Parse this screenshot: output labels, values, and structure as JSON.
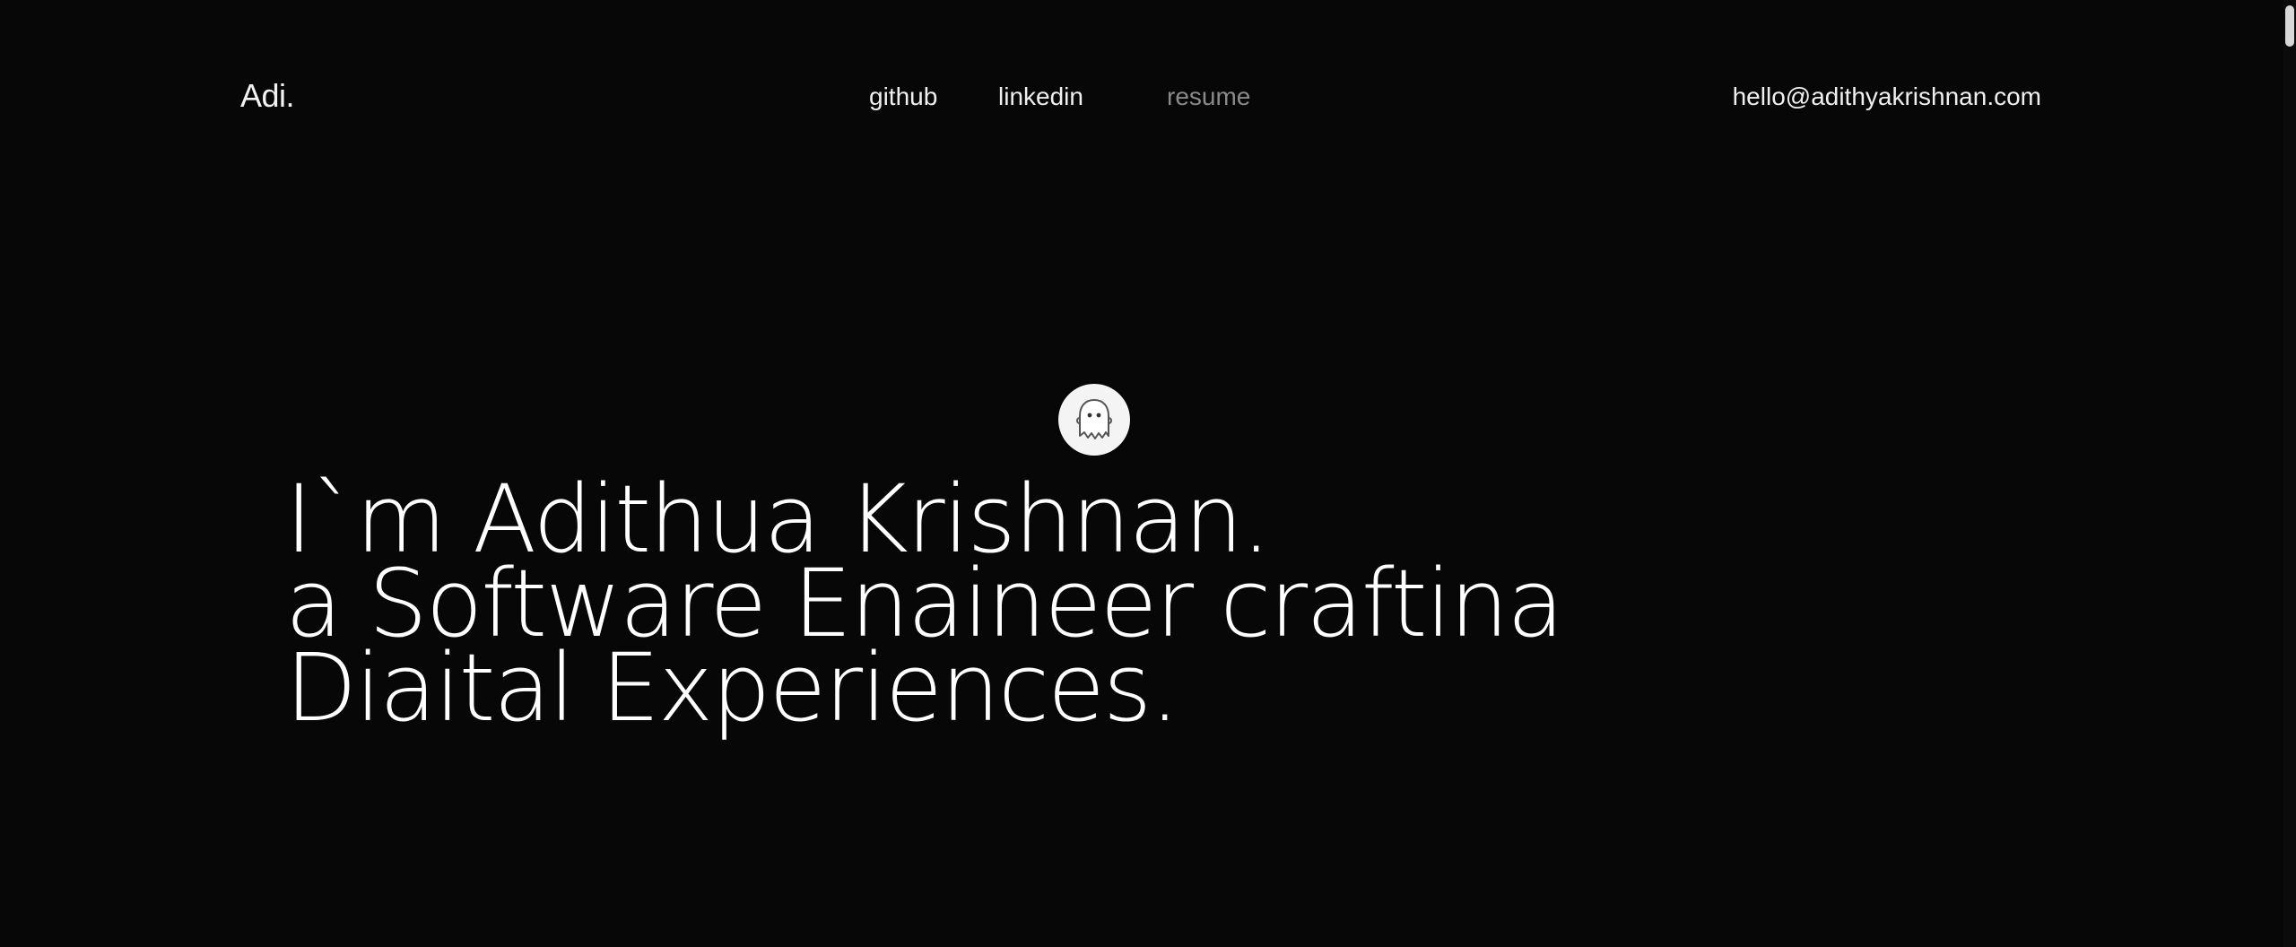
{
  "header": {
    "logo": "Adi.",
    "nav": {
      "github": "github",
      "linkedin": "linkedin",
      "resume": "resume"
    },
    "email": "hello@adithyakrishnan.com"
  },
  "hero": {
    "line1": "I`m Adithua Krishnan.",
    "line2": "a Software Enaineer craftina",
    "line3": "Diaital Experiences."
  },
  "cursor": {
    "icon": "ghost-icon"
  },
  "colors": {
    "background": "#070707",
    "text": "#ffffff",
    "muted": "#8a8a8a"
  }
}
